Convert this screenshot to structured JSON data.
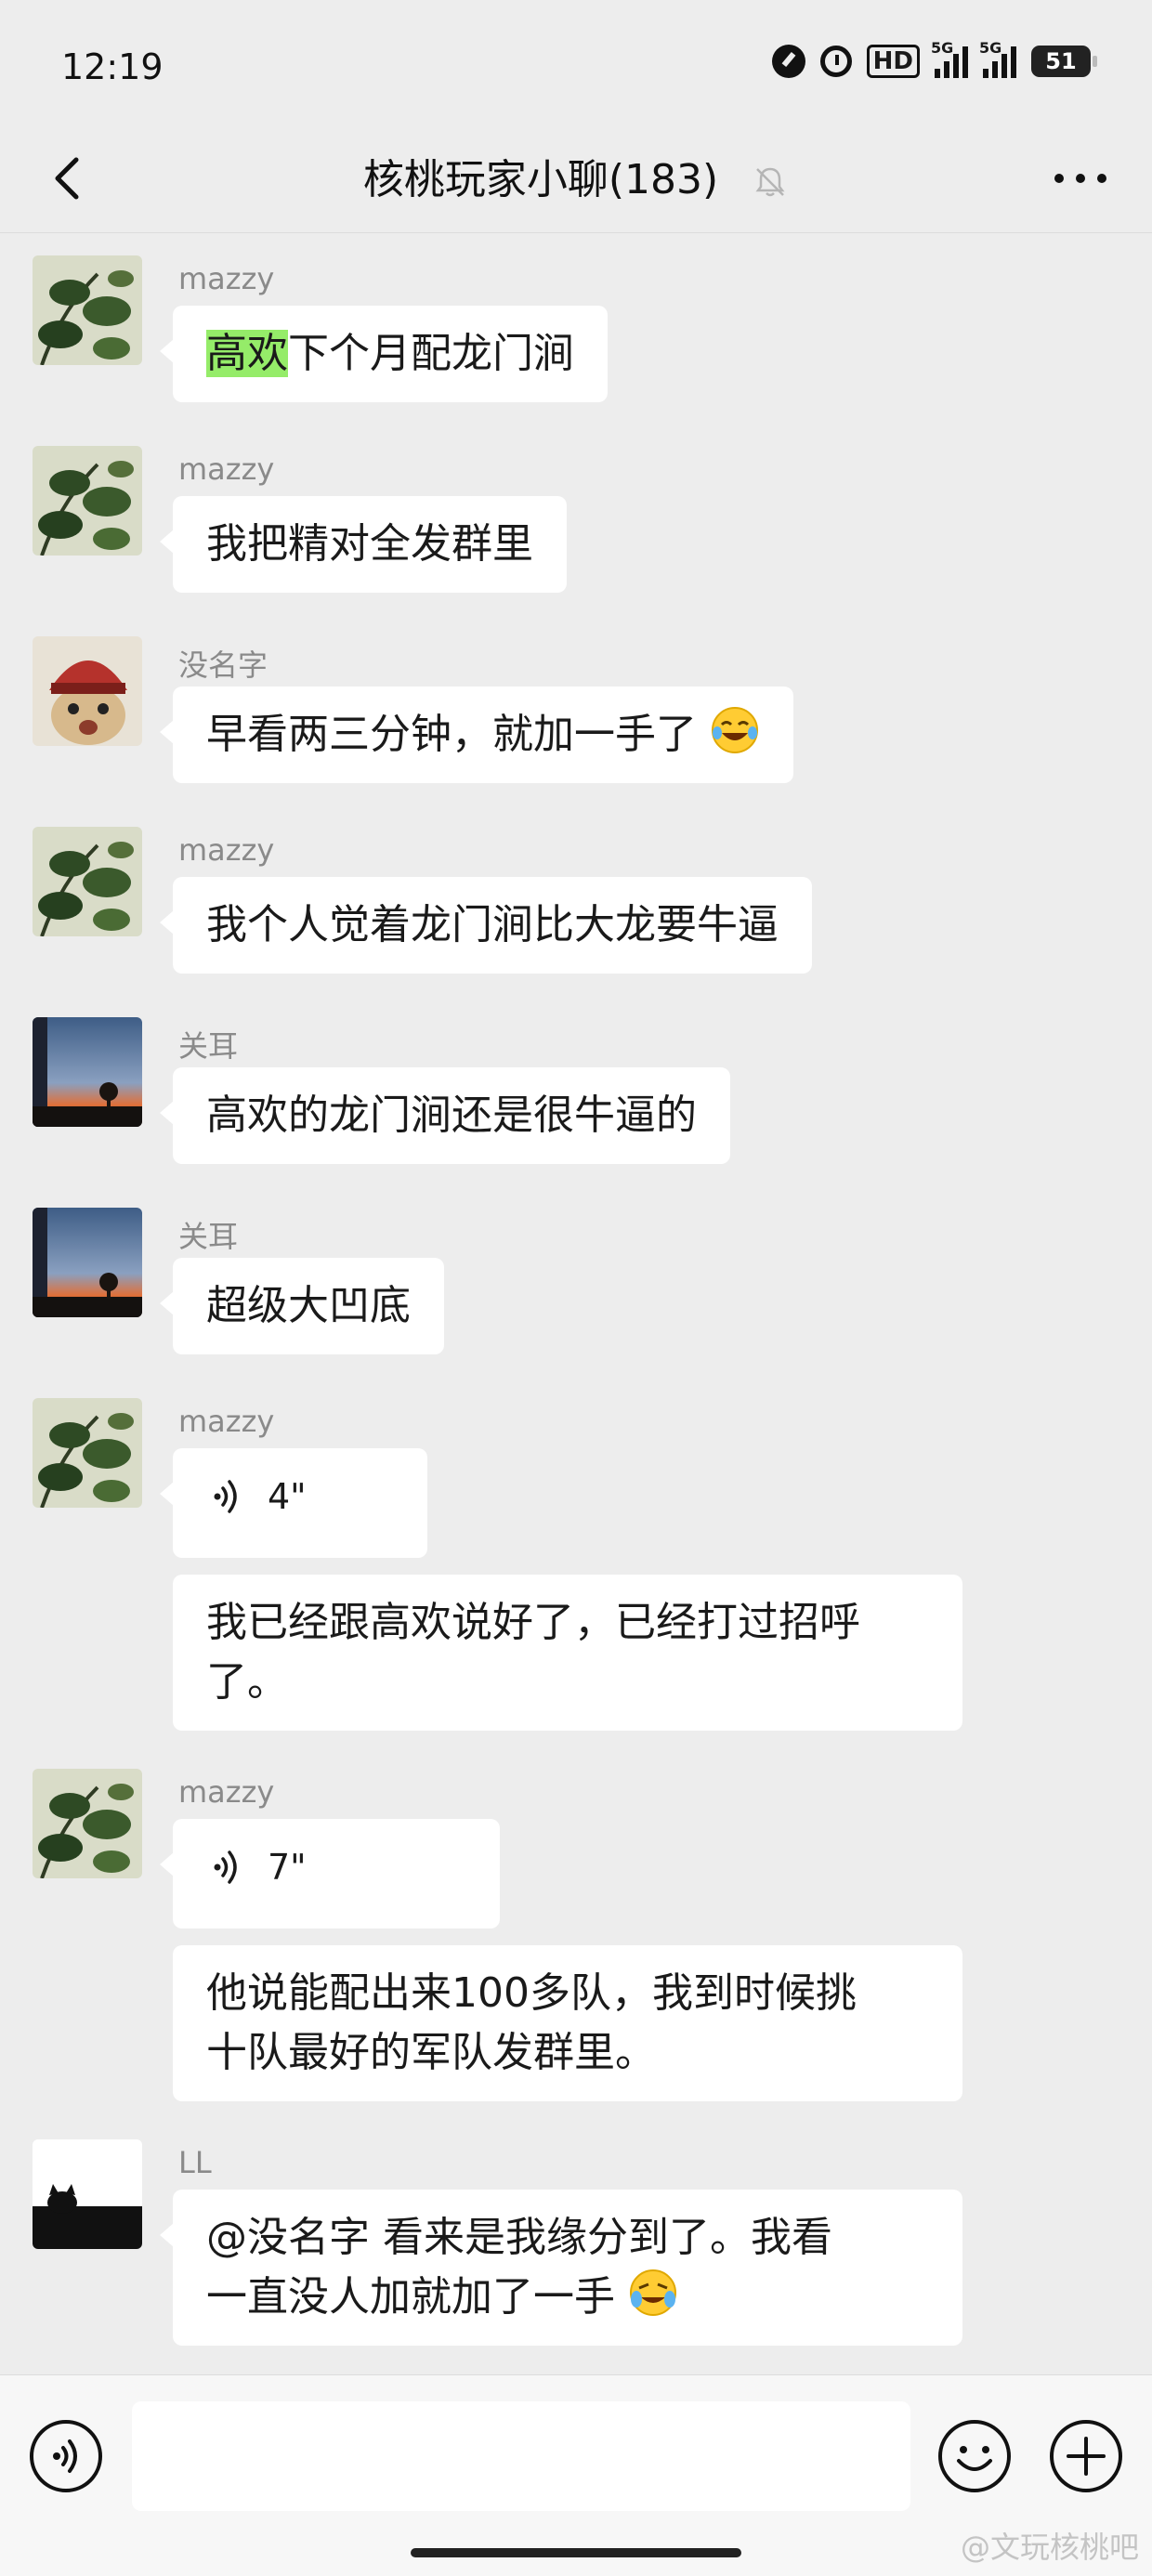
{
  "status_bar": {
    "time": "12:19",
    "hd_label": "HD",
    "network_label_1": "5G",
    "network_label_2": "5G",
    "battery": "51",
    "icons": [
      "speedometer-icon",
      "alarm-icon",
      "hd-icon",
      "signal-icon",
      "signal-icon",
      "battery-icon"
    ]
  },
  "header": {
    "title": "核桃玩家小聊(183)",
    "icons": [
      "back-arrow-icon",
      "mute-bell-icon",
      "more-dots-icon"
    ]
  },
  "messages": [
    {
      "sender": "mazzy",
      "highlight": "高欢",
      "text": "下个月配龙门涧"
    },
    {
      "sender": "mazzy",
      "text": "我把精对全发群里"
    },
    {
      "sender": "没名字",
      "text": "早看两三分钟，就加一手了",
      "emoji": "laughing-tears-emoji"
    },
    {
      "sender": "mazzy",
      "text": "我个人觉着龙门涧比大龙要牛逼"
    },
    {
      "sender": "关耳",
      "text": "高欢的龙门涧还是很牛逼的"
    },
    {
      "sender": "关耳",
      "text": "超级大凹底"
    },
    {
      "sender": "mazzy",
      "voice": "4\"",
      "text2_line1": "我已经跟高欢说好了，已经打过招呼",
      "text2_line2": "了。"
    },
    {
      "sender": "mazzy",
      "voice": "7\"",
      "text2_line1": "他说能配出来100多队，我到时候挑",
      "text2_line2": "十队最好的军队发群里。"
    },
    {
      "sender": "LL",
      "line1": "@没名字  看来是我缘分到了。我看",
      "line2": "一直没人加就加了一手",
      "emoji": "crying-laughing-emoji"
    }
  ],
  "input_bar": {
    "placeholder": "",
    "icons": [
      "voice-toggle-icon",
      "emoji-icon",
      "plus-icon"
    ]
  },
  "watermark": "@文玩核桃吧",
  "colors": {
    "background": "#ededed",
    "bubble": "#ffffff",
    "highlight": "#95ec69",
    "name": "#8a8a8a"
  }
}
